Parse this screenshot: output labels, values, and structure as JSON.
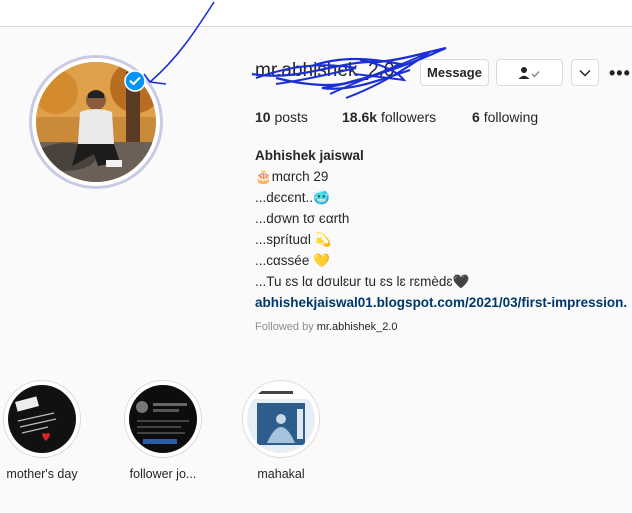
{
  "profile": {
    "username": "mr.abhishek_2.0",
    "message_label": "Message",
    "follow_icon": "person-check-icon",
    "more_icon": "chevron-down-icon",
    "options_glyph": "•••"
  },
  "stats": {
    "posts_count": "10",
    "posts_label": "posts",
    "followers_count": "18.6k",
    "followers_label": "followers",
    "following_count": "6",
    "following_label": "following"
  },
  "bio": {
    "name": "Abhishek jaiswal",
    "lines": [
      "🎂mαrch 29",
      "...dєcєnt..🥶",
      "...dσwn tσ єαrth",
      "...sprítuαl 💫",
      "...cαssée 💛",
      "...Tu ɛs lα dσulɛur tu ɛs lɛ rɛmèdɛ🖤"
    ],
    "link": "abhishekjaiswal01.blogspot.com/2021/03/first-impression.",
    "followed_by_prefix": "Followed by",
    "followed_by_user": "mr.abhishek_2.0"
  },
  "highlights": [
    {
      "label": "mother's day"
    },
    {
      "label": "follower jo..."
    },
    {
      "label": "mahakal"
    }
  ],
  "colors": {
    "link": "#00376b",
    "verified": "#0095f6",
    "pen": "#1a2fd6"
  }
}
